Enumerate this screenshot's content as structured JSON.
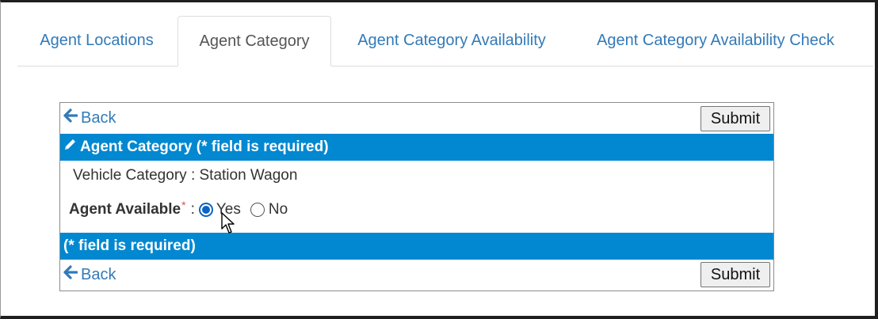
{
  "tabs": [
    {
      "label": "Agent Locations",
      "active": false
    },
    {
      "label": "Agent Category",
      "active": true
    },
    {
      "label": "Agent Category Availability",
      "active": false
    },
    {
      "label": "Agent Category Availability Check",
      "active": false
    }
  ],
  "panel": {
    "back_label": "Back",
    "submit_label": "Submit",
    "header_title": "Agent Category (* field is required)",
    "vehicle_category": {
      "label": "Vehicle Category",
      "separator": ":",
      "value": "Station Wagon"
    },
    "agent_available": {
      "label": "Agent Available",
      "required_mark": "*",
      "separator": ":",
      "options": [
        {
          "label": "Yes",
          "selected": true
        },
        {
          "label": "No",
          "selected": false
        }
      ]
    },
    "footer_note": "(* field is required)"
  },
  "colors": {
    "header_bar": "#0288d1",
    "link": "#337ab7",
    "required": "#d9534f",
    "radio_selected": "#0b63c4"
  },
  "icons": {
    "back": "arrow-left-icon",
    "edit": "pencil-icon"
  }
}
